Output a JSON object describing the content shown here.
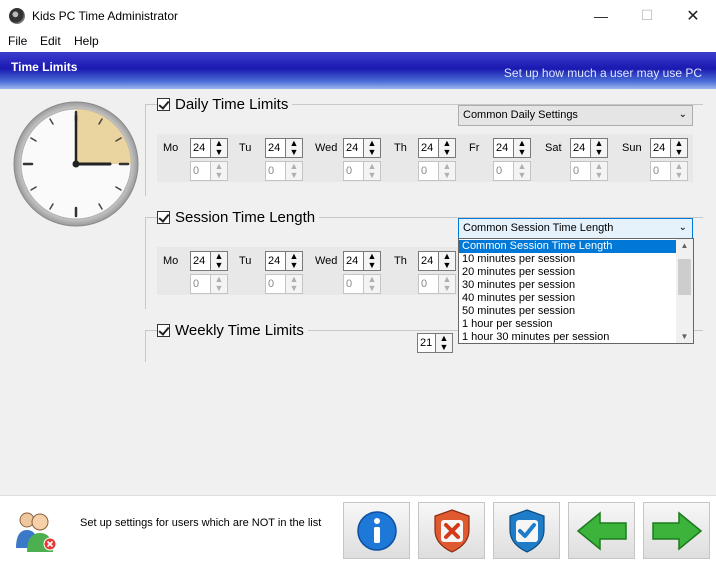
{
  "window": {
    "title": "Kids PC Time Administrator"
  },
  "menu": [
    "File",
    "Edit",
    "Help"
  ],
  "header": {
    "title": "Time Limits",
    "subtitle": "Set up how much a user may use PC"
  },
  "daily": {
    "title": "Daily Time Limits",
    "combo": "Common Daily Settings",
    "checked": true,
    "days": [
      {
        "label": "Mo",
        "hours": "24",
        "minutes": "0"
      },
      {
        "label": "Tu",
        "hours": "24",
        "minutes": "0"
      },
      {
        "label": "Wed",
        "hours": "24",
        "minutes": "0"
      },
      {
        "label": "Th",
        "hours": "24",
        "minutes": "0"
      },
      {
        "label": "Fr",
        "hours": "24",
        "minutes": "0"
      },
      {
        "label": "Sat",
        "hours": "24",
        "minutes": "0"
      },
      {
        "label": "Sun",
        "hours": "24",
        "minutes": "0"
      }
    ]
  },
  "session": {
    "title": "Session Time Length",
    "combo": "Common Session Time Length",
    "checked": true,
    "days": [
      {
        "label": "Mo",
        "hours": "24",
        "minutes": "0"
      },
      {
        "label": "Tu",
        "hours": "24",
        "minutes": "0"
      },
      {
        "label": "Wed",
        "hours": "24",
        "minutes": "0"
      },
      {
        "label": "Th",
        "hours": "24",
        "minutes": "0"
      }
    ],
    "options": [
      "Common Session Time Length",
      "10 minutes per session",
      "20 minutes per session",
      "30 minutes per session",
      "40 minutes per session",
      "50 minutes per session",
      "1 hour per session",
      "1 hour 30 minutes per session"
    ]
  },
  "weekly": {
    "title": "Weekly Time Limits",
    "hours": "21",
    "checked": true
  },
  "footer": {
    "text": "Set up settings for users which are NOT in the list"
  },
  "colors": {
    "header_blue": "#1a1ab0",
    "selection": "#0078d7",
    "panel_bg": "#f0f0f0"
  }
}
